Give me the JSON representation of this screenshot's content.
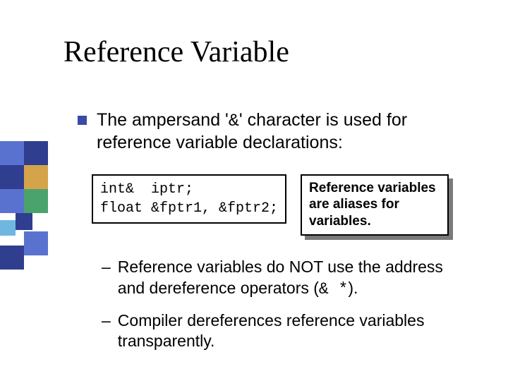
{
  "title": "Reference Variable",
  "bullet": {
    "pre": "The ampersand '",
    "amp": "&",
    "post": "' character is used for reference variable declarations:"
  },
  "code": "int&  iptr;\nfloat &fptr1, &fptr2;",
  "note": "Reference variables are aliases for variables.",
  "sub": {
    "a_pre": "Reference variables do NOT use the address and dereference operators (",
    "a_ops": "& *",
    "a_post": ").",
    "b": "Compiler dereferences reference variables transparently."
  },
  "decor": [
    {
      "l": 0,
      "t": 0,
      "s": 34,
      "c": "#5a72cf"
    },
    {
      "l": 34,
      "t": 0,
      "s": 34,
      "c": "#2f3e8f"
    },
    {
      "l": 0,
      "t": 34,
      "s": 34,
      "c": "#2f3e8f"
    },
    {
      "l": 34,
      "t": 34,
      "s": 34,
      "c": "#d5a44a"
    },
    {
      "l": 0,
      "t": 68,
      "s": 34,
      "c": "#5a72cf"
    },
    {
      "l": 34,
      "t": 68,
      "s": 34,
      "c": "#4aa36c"
    },
    {
      "l": 22,
      "t": 102,
      "s": 24,
      "c": "#2f3e8f"
    },
    {
      "l": 0,
      "t": 112,
      "s": 22,
      "c": "#6fb7e0"
    },
    {
      "l": 34,
      "t": 128,
      "s": 34,
      "c": "#5a72cf"
    },
    {
      "l": 0,
      "t": 148,
      "s": 34,
      "c": "#2f3e8f"
    }
  ]
}
